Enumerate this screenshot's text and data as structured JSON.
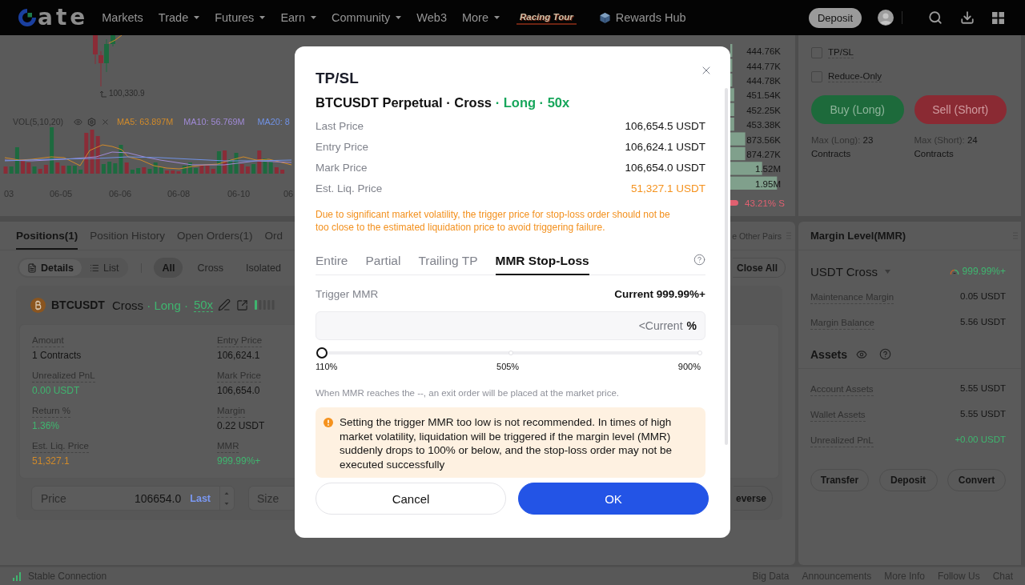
{
  "nav": {
    "logo_text": "ate",
    "items": [
      {
        "label": "Markets",
        "dropdown": false
      },
      {
        "label": "Trade",
        "dropdown": true
      },
      {
        "label": "Futures",
        "dropdown": true
      },
      {
        "label": "Earn",
        "dropdown": true
      },
      {
        "label": "Community",
        "dropdown": true
      },
      {
        "label": "Web3",
        "dropdown": false
      },
      {
        "label": "More",
        "dropdown": true
      }
    ],
    "promo": "Racing Tour",
    "rewards": "Rewards Hub",
    "deposit": "Deposit"
  },
  "chart": {
    "low_price": "100,330.9",
    "indicator": "VOL(5,10,20)",
    "averages": [
      {
        "label": "MA5: 63.897M",
        "color": "#d08a2a"
      },
      {
        "label": "MA10: 56.769M",
        "color": "#a08ad6"
      },
      {
        "label": "MA20: 8",
        "color": "#7092e6"
      }
    ],
    "dates": [
      "03",
      "06-05",
      "06-06",
      "06-08",
      "06-10",
      "06"
    ]
  },
  "order_book": {
    "rows": [
      {
        "amount": "444.76K"
      },
      {
        "amount": "444.77K"
      },
      {
        "amount": "444.78K"
      },
      {
        "amount": "451.54K"
      },
      {
        "amount": "452.25K"
      },
      {
        "amount": "453.38K"
      },
      {
        "amount": "873.56K"
      },
      {
        "amount": "874.27K"
      },
      {
        "amount": "1.52M"
      },
      {
        "amount": "1.95M"
      }
    ],
    "ratio": "43.21% S"
  },
  "order_form": {
    "options": [
      {
        "label": "TP/SL",
        "checked": false
      },
      {
        "label": "Reduce-Only",
        "checked": false
      }
    ],
    "buttons": [
      {
        "label": "Buy (Long)",
        "kind": "buy"
      },
      {
        "label": "Sell (Short)",
        "kind": "sell"
      }
    ],
    "max": [
      {
        "label": "Max (Long):",
        "value": "23 Contracts"
      },
      {
        "label": "Max (Short):",
        "value": "24 Contracts"
      }
    ]
  },
  "positions": {
    "tabs": [
      {
        "label": "Positions(1)",
        "selected": true
      },
      {
        "label": "Position History",
        "selected": false
      },
      {
        "label": "Open Orders(1)",
        "selected": false
      },
      {
        "label": "Ord",
        "selected": false
      }
    ],
    "pair_filter": "e Other Pairs",
    "views": [
      {
        "label": "Details",
        "kind": "details",
        "selected": true
      },
      {
        "label": "List",
        "kind": "list",
        "selected": false
      }
    ],
    "filters": [
      {
        "label": "All",
        "selected": true
      },
      {
        "label": "Cross",
        "selected": false
      },
      {
        "label": "Isolated",
        "selected": false
      }
    ],
    "close_all": "Close All",
    "position": {
      "symbol": "BTCUSDT",
      "mode": "Cross",
      "side": "· Long ·",
      "leverage": "50x",
      "risk": {
        "level": 0.2
      },
      "fields": [
        {
          "label": "Amount",
          "value": "1 Contracts",
          "kind": "normal"
        },
        {
          "label": "Entry Price",
          "value": "106,624.1",
          "kind": "normal"
        },
        {
          "label": "Unrealized PnL",
          "value": "0.00 USDT",
          "kind": "positive"
        },
        {
          "label": "Mark Price",
          "value": "106,654.0",
          "kind": "normal"
        },
        {
          "label": "Return %",
          "value": "1.36%",
          "kind": "positive"
        },
        {
          "label": "Margin",
          "value": "0.22 USDT",
          "kind": "normal"
        },
        {
          "label": "Est. Liq. Price",
          "value": "51,327.1",
          "kind": "warning"
        },
        {
          "label": "MMR",
          "value": "999.99%+",
          "kind": "positive"
        }
      ],
      "price_label": "Price",
      "price_value": "106654.0",
      "price_tag": "Last",
      "size_placeholder": "Size",
      "reverse": "everse"
    }
  },
  "margin": {
    "title": "Margin Level(MMR)",
    "account": "USDT Cross",
    "ratio": "999.99%+",
    "rows": [
      {
        "label": "Maintenance Margin",
        "value": "0.05 USDT"
      },
      {
        "label": "Margin Balance",
        "value": "5.56 USDT"
      }
    ],
    "assets_title": "Assets",
    "assets": [
      {
        "label": "Account Assets",
        "value": "5.55 USDT",
        "kind": "normal"
      },
      {
        "label": "Wallet Assets",
        "value": "5.55 USDT",
        "kind": "normal"
      },
      {
        "label": "Unrealized PnL",
        "value": "+0.00 USDT",
        "kind": "positive"
      }
    ],
    "actions": [
      "Transfer",
      "Deposit",
      "Convert"
    ]
  },
  "status_bar": {
    "connection": "Stable Connection",
    "links": [
      "Big Data",
      "Announcements",
      "More Info",
      "Follow Us",
      "Chat"
    ]
  },
  "modal": {
    "title": "TP/SL",
    "position": "BTCUSDT Perpetual · Cross",
    "position_tags": "· Long · 50x",
    "prices": [
      {
        "label": "Last Price",
        "value": "106,654.5 USDT",
        "kind": "normal"
      },
      {
        "label": "Entry Price",
        "value": "106,624.1 USDT",
        "kind": "normal"
      },
      {
        "label": "Mark Price",
        "value": "106,654.0 USDT",
        "kind": "normal"
      },
      {
        "label": "Est. Liq. Price",
        "value": "51,327.1 USDT",
        "kind": "warning"
      }
    ],
    "notice": "Due to significant market volatility, the trigger price for stop-loss order should not be too close to the estimated liquidation price to avoid triggering failure.",
    "tabs": [
      {
        "label": "Entire",
        "selected": false
      },
      {
        "label": "Partial",
        "selected": false
      },
      {
        "label": "Trailing TP",
        "selected": false
      },
      {
        "label": "MMR Stop-Loss",
        "selected": true
      }
    ],
    "trigger_label": "Trigger MMR",
    "current_label": "Current",
    "current_value": "999.99%+",
    "trigger_input": {
      "placeholder": "<Current",
      "unit": "%"
    },
    "slider": {
      "level": 0,
      "marks": [
        "110%",
        "505%",
        "900%"
      ]
    },
    "hint": "When MMR reaches the --, an exit order will be placed at the market price.",
    "warning": "Setting the trigger MMR too low is not recommended. In times of high market volatility, liquidation will be triggered if the margin level (MMR) suddenly drops to 100% or below, and the stop-loss order may not be executed successfully",
    "buttons": [
      {
        "label": "Cancel",
        "kind": "secondary"
      },
      {
        "label": "OK",
        "kind": "primary"
      }
    ]
  }
}
